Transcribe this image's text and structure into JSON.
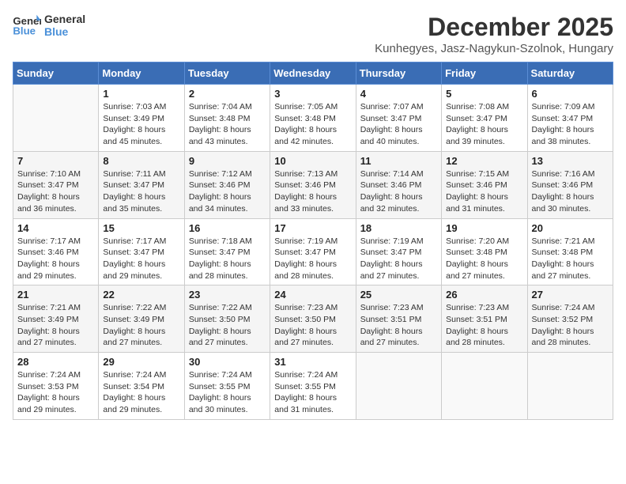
{
  "header": {
    "logo_line1": "General",
    "logo_line2": "Blue",
    "month_year": "December 2025",
    "location": "Kunhegyes, Jasz-Nagykun-Szolnok, Hungary"
  },
  "weekdays": [
    "Sunday",
    "Monday",
    "Tuesday",
    "Wednesday",
    "Thursday",
    "Friday",
    "Saturday"
  ],
  "weeks": [
    [
      {
        "day": "",
        "info": ""
      },
      {
        "day": "1",
        "info": "Sunrise: 7:03 AM\nSunset: 3:49 PM\nDaylight: 8 hours\nand 45 minutes."
      },
      {
        "day": "2",
        "info": "Sunrise: 7:04 AM\nSunset: 3:48 PM\nDaylight: 8 hours\nand 43 minutes."
      },
      {
        "day": "3",
        "info": "Sunrise: 7:05 AM\nSunset: 3:48 PM\nDaylight: 8 hours\nand 42 minutes."
      },
      {
        "day": "4",
        "info": "Sunrise: 7:07 AM\nSunset: 3:47 PM\nDaylight: 8 hours\nand 40 minutes."
      },
      {
        "day": "5",
        "info": "Sunrise: 7:08 AM\nSunset: 3:47 PM\nDaylight: 8 hours\nand 39 minutes."
      },
      {
        "day": "6",
        "info": "Sunrise: 7:09 AM\nSunset: 3:47 PM\nDaylight: 8 hours\nand 38 minutes."
      }
    ],
    [
      {
        "day": "7",
        "info": "Sunrise: 7:10 AM\nSunset: 3:47 PM\nDaylight: 8 hours\nand 36 minutes."
      },
      {
        "day": "8",
        "info": "Sunrise: 7:11 AM\nSunset: 3:47 PM\nDaylight: 8 hours\nand 35 minutes."
      },
      {
        "day": "9",
        "info": "Sunrise: 7:12 AM\nSunset: 3:46 PM\nDaylight: 8 hours\nand 34 minutes."
      },
      {
        "day": "10",
        "info": "Sunrise: 7:13 AM\nSunset: 3:46 PM\nDaylight: 8 hours\nand 33 minutes."
      },
      {
        "day": "11",
        "info": "Sunrise: 7:14 AM\nSunset: 3:46 PM\nDaylight: 8 hours\nand 32 minutes."
      },
      {
        "day": "12",
        "info": "Sunrise: 7:15 AM\nSunset: 3:46 PM\nDaylight: 8 hours\nand 31 minutes."
      },
      {
        "day": "13",
        "info": "Sunrise: 7:16 AM\nSunset: 3:46 PM\nDaylight: 8 hours\nand 30 minutes."
      }
    ],
    [
      {
        "day": "14",
        "info": "Sunrise: 7:17 AM\nSunset: 3:46 PM\nDaylight: 8 hours\nand 29 minutes."
      },
      {
        "day": "15",
        "info": "Sunrise: 7:17 AM\nSunset: 3:47 PM\nDaylight: 8 hours\nand 29 minutes."
      },
      {
        "day": "16",
        "info": "Sunrise: 7:18 AM\nSunset: 3:47 PM\nDaylight: 8 hours\nand 28 minutes."
      },
      {
        "day": "17",
        "info": "Sunrise: 7:19 AM\nSunset: 3:47 PM\nDaylight: 8 hours\nand 28 minutes."
      },
      {
        "day": "18",
        "info": "Sunrise: 7:19 AM\nSunset: 3:47 PM\nDaylight: 8 hours\nand 27 minutes."
      },
      {
        "day": "19",
        "info": "Sunrise: 7:20 AM\nSunset: 3:48 PM\nDaylight: 8 hours\nand 27 minutes."
      },
      {
        "day": "20",
        "info": "Sunrise: 7:21 AM\nSunset: 3:48 PM\nDaylight: 8 hours\nand 27 minutes."
      }
    ],
    [
      {
        "day": "21",
        "info": "Sunrise: 7:21 AM\nSunset: 3:49 PM\nDaylight: 8 hours\nand 27 minutes."
      },
      {
        "day": "22",
        "info": "Sunrise: 7:22 AM\nSunset: 3:49 PM\nDaylight: 8 hours\nand 27 minutes."
      },
      {
        "day": "23",
        "info": "Sunrise: 7:22 AM\nSunset: 3:50 PM\nDaylight: 8 hours\nand 27 minutes."
      },
      {
        "day": "24",
        "info": "Sunrise: 7:23 AM\nSunset: 3:50 PM\nDaylight: 8 hours\nand 27 minutes."
      },
      {
        "day": "25",
        "info": "Sunrise: 7:23 AM\nSunset: 3:51 PM\nDaylight: 8 hours\nand 27 minutes."
      },
      {
        "day": "26",
        "info": "Sunrise: 7:23 AM\nSunset: 3:51 PM\nDaylight: 8 hours\nand 28 minutes."
      },
      {
        "day": "27",
        "info": "Sunrise: 7:24 AM\nSunset: 3:52 PM\nDaylight: 8 hours\nand 28 minutes."
      }
    ],
    [
      {
        "day": "28",
        "info": "Sunrise: 7:24 AM\nSunset: 3:53 PM\nDaylight: 8 hours\nand 29 minutes."
      },
      {
        "day": "29",
        "info": "Sunrise: 7:24 AM\nSunset: 3:54 PM\nDaylight: 8 hours\nand 29 minutes."
      },
      {
        "day": "30",
        "info": "Sunrise: 7:24 AM\nSunset: 3:55 PM\nDaylight: 8 hours\nand 30 minutes."
      },
      {
        "day": "31",
        "info": "Sunrise: 7:24 AM\nSunset: 3:55 PM\nDaylight: 8 hours\nand 31 minutes."
      },
      {
        "day": "",
        "info": ""
      },
      {
        "day": "",
        "info": ""
      },
      {
        "day": "",
        "info": ""
      }
    ]
  ]
}
